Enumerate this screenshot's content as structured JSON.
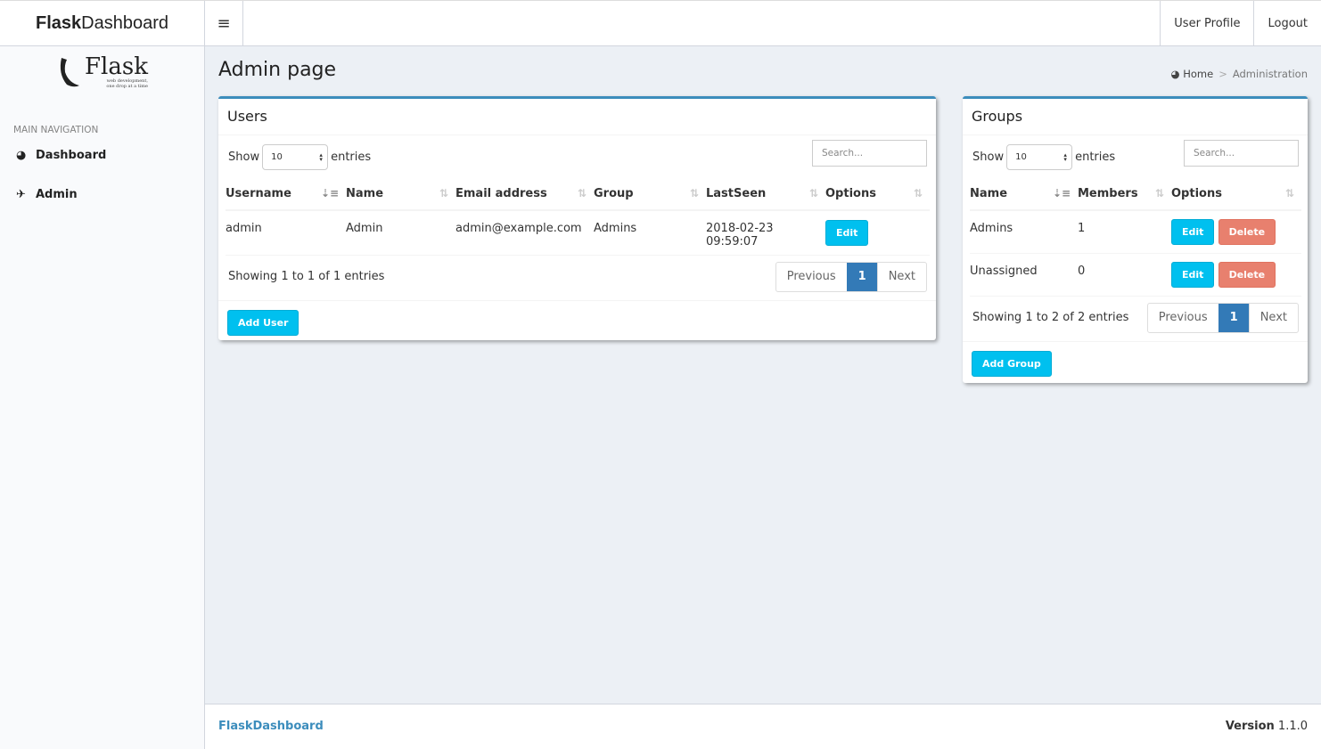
{
  "header": {
    "brand_bold": "Flask",
    "brand_light": "Dashboard",
    "user_profile": "User Profile",
    "logout": "Logout"
  },
  "sidebar": {
    "logo_word": "Flask",
    "logo_tagline": "web development, one drop at a time",
    "nav_header": "MAIN NAVIGATION",
    "items": [
      {
        "label": "Dashboard",
        "icon": "dashboard-icon"
      },
      {
        "label": "Admin",
        "icon": "plane-icon"
      }
    ]
  },
  "page": {
    "title": "Admin page",
    "breadcrumb": [
      "Home",
      "Administration"
    ]
  },
  "users": {
    "title": "Users",
    "show": "Show",
    "entries": "entries",
    "length": "10",
    "search_placeholder": "Search...",
    "columns": [
      "Username",
      "Name",
      "Email address",
      "Group",
      "LastSeen",
      "Options"
    ],
    "rows": [
      {
        "username": "admin",
        "name": "Admin",
        "email": "admin@example.com",
        "group": "Admins",
        "last_seen": "2018-02-23 09:59:07",
        "edit": "Edit"
      }
    ],
    "info": "Showing 1 to 1 of 1 entries",
    "prev": "Previous",
    "page": "1",
    "next": "Next",
    "add": "Add User"
  },
  "groups": {
    "title": "Groups",
    "show": "Show",
    "entries": "entries",
    "length": "10",
    "search_placeholder": "Search...",
    "columns": [
      "Name",
      "Members",
      "Options"
    ],
    "rows": [
      {
        "name": "Admins",
        "members": "1",
        "edit": "Edit",
        "delete": "Delete"
      },
      {
        "name": "Unassigned",
        "members": "0",
        "edit": "Edit",
        "delete": "Delete"
      }
    ],
    "info": "Showing 1 to 2 of 2 entries",
    "prev": "Previous",
    "page": "1",
    "next": "Next",
    "add": "Add Group"
  },
  "footer": {
    "brand": "FlaskDashboard",
    "version_label": "Version",
    "version": "1.1.0"
  },
  "colors": {
    "primary": "#3c8dbc",
    "info": "#00c0ef",
    "danger": "#e8806e",
    "page_active": "#337ab7"
  }
}
